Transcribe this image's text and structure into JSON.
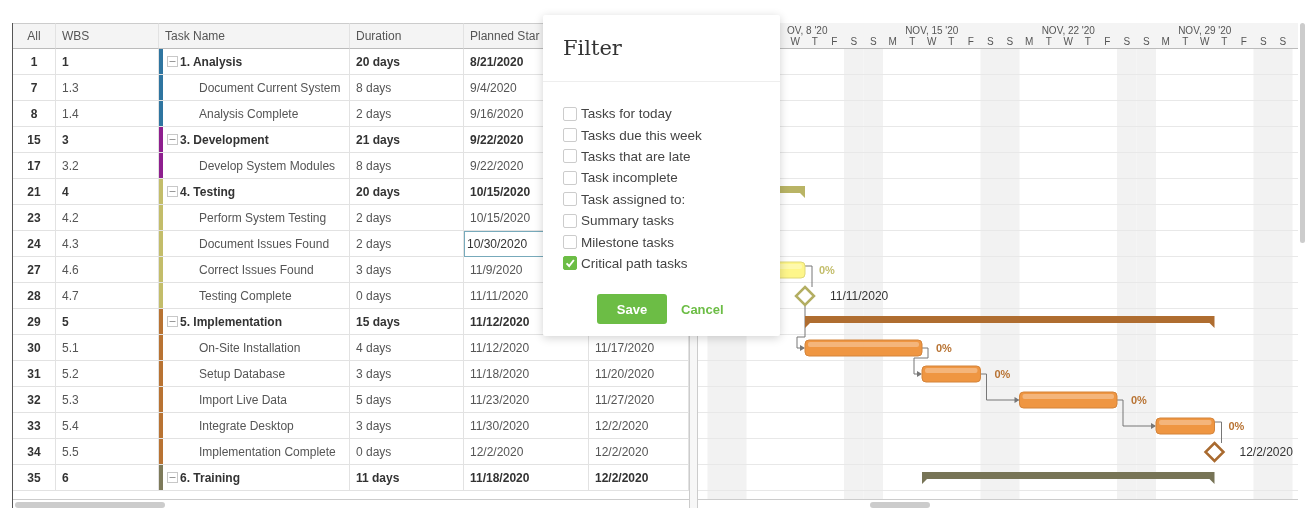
{
  "columns": [
    "All",
    "WBS",
    "Task Name",
    "Duration",
    "Planned Star"
  ],
  "rows": [
    {
      "id": "1",
      "wbs": "1",
      "name": "1. Analysis",
      "kind": "summary",
      "expanded": true,
      "color": "#2f75a0",
      "duration": "20 days",
      "start": "8/21/2020"
    },
    {
      "id": "7",
      "wbs": "1.3",
      "name": "Document Current System",
      "kind": "task",
      "color": "#2f75a0",
      "duration": "8 days",
      "start": "9/4/2020"
    },
    {
      "id": "8",
      "wbs": "1.4",
      "name": "Analysis Complete",
      "kind": "task",
      "color": "#2f75a0",
      "duration": "2 days",
      "start": "9/16/2020"
    },
    {
      "id": "15",
      "wbs": "3",
      "name": "3. Development",
      "kind": "summary",
      "expanded": true,
      "color": "#8e1f8e",
      "duration": "21 days",
      "start": "9/22/2020"
    },
    {
      "id": "17",
      "wbs": "3.2",
      "name": "Develop System Modules",
      "kind": "task",
      "color": "#8e1f8e",
      "duration": "8 days",
      "start": "9/22/2020"
    },
    {
      "id": "21",
      "wbs": "4",
      "name": "4. Testing",
      "kind": "summary",
      "expanded": true,
      "color": "#c3bd6a",
      "duration": "20 days",
      "start": "10/15/2020"
    },
    {
      "id": "23",
      "wbs": "4.2",
      "name": "Perform System Testing",
      "kind": "task",
      "color": "#c3bd6a",
      "duration": "2 days",
      "start": "10/15/2020"
    },
    {
      "id": "24",
      "wbs": "4.3",
      "name": "Document Issues Found",
      "kind": "task",
      "color": "#c3bd6a",
      "duration": "2 days",
      "start": "10/30/2020",
      "start_focused": true
    },
    {
      "id": "27",
      "wbs": "4.6",
      "name": "Correct Issues Found",
      "kind": "task",
      "color": "#c3bd6a",
      "duration": "3 days",
      "start": "11/9/2020",
      "progress_label": "0%",
      "linked_to_next": true
    },
    {
      "id": "28",
      "wbs": "4.7",
      "name": "Testing Complete",
      "kind": "milestone",
      "color": "#c3bd6a",
      "duration": "0 days",
      "start": "11/11/2020",
      "milestone_label": "11/11/2020",
      "linked_to_next": true
    },
    {
      "id": "29",
      "wbs": "5",
      "name": "5. Implementation",
      "kind": "summary",
      "expanded": true,
      "color": "#b87333",
      "duration": "15 days",
      "start": "11/12/2020"
    },
    {
      "id": "30",
      "wbs": "5.1",
      "name": "On-Site Installation",
      "kind": "task",
      "color": "#b87333",
      "duration": "4 days",
      "start": "11/12/2020",
      "finish": "11/17/2020",
      "progress_label": "0%",
      "linked_to_next": true
    },
    {
      "id": "31",
      "wbs": "5.2",
      "name": "Setup Database",
      "kind": "task",
      "color": "#b87333",
      "duration": "3 days",
      "start": "11/18/2020",
      "finish": "11/20/2020",
      "progress_label": "0%",
      "linked_to_next": true
    },
    {
      "id": "32",
      "wbs": "5.3",
      "name": "Import Live Data",
      "kind": "task",
      "color": "#b87333",
      "duration": "5 days",
      "start": "11/23/2020",
      "finish": "11/27/2020",
      "progress_label": "0%",
      "linked_to_next": true
    },
    {
      "id": "33",
      "wbs": "5.4",
      "name": "Integrate Desktop",
      "kind": "task",
      "color": "#b87333",
      "duration": "3 days",
      "start": "11/30/2020",
      "finish": "12/2/2020",
      "progress_label": "0%",
      "linked_to_next": true
    },
    {
      "id": "34",
      "wbs": "5.5",
      "name": "Implementation Complete",
      "kind": "milestone",
      "color": "#b87333",
      "duration": "0 days",
      "start": "12/2/2020",
      "finish": "12/2/2020",
      "milestone_label": "12/2/2020"
    },
    {
      "id": "35",
      "wbs": "6",
      "name": "6. Training",
      "kind": "summary",
      "expanded": true,
      "color": "#7d7a5a",
      "duration": "11 days",
      "start": "11/18/2020",
      "finish": "12/2/2020"
    }
  ],
  "timeline": {
    "weeks": [
      "OV, 8 '20",
      "NOV, 15 '20",
      "NOV, 22 '20",
      "NOV, 29 '20"
    ],
    "days": [
      "W",
      "T",
      "F",
      "S",
      "S",
      "M",
      "T",
      "W",
      "T",
      "F",
      "S",
      "S",
      "M",
      "T",
      "W",
      "T",
      "F",
      "S",
      "S",
      "M",
      "T",
      "W",
      "T",
      "F",
      "S",
      "S"
    ]
  },
  "filter": {
    "title": "Filter",
    "options": [
      {
        "label": "Tasks for today",
        "checked": false
      },
      {
        "label": "Tasks due this week",
        "checked": false
      },
      {
        "label": "Tasks that are late",
        "checked": false
      },
      {
        "label": "Task incomplete",
        "checked": false
      },
      {
        "label": "Task assigned to:",
        "checked": false
      },
      {
        "label": "Summary tasks",
        "checked": false
      },
      {
        "label": "Milestone tasks",
        "checked": false
      },
      {
        "label": "Critical path tasks",
        "checked": true
      }
    ],
    "buttons": [
      {
        "label": "Save",
        "kind": "primary"
      },
      {
        "label": "Cancel",
        "kind": "link"
      }
    ]
  }
}
